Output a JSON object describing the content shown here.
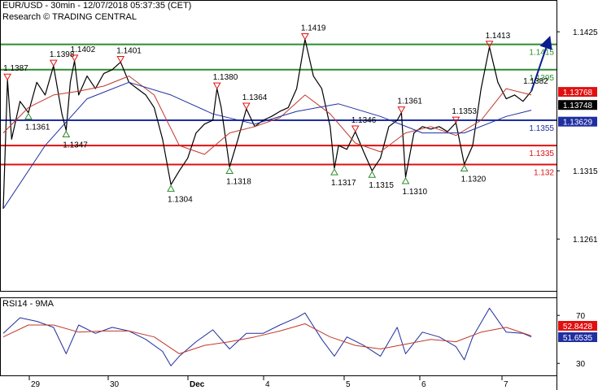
{
  "header": {
    "title": "EUR/USD - 30min - 12/07/2018 05:37:35 (CET)",
    "source": "Research © TRADING CENTRAL"
  },
  "colors": {
    "background": "#ffffff",
    "price": "#000000",
    "ma_fast": "#c0392b",
    "ma_slow": "#1f2fa0",
    "resistance": "#2e8b2e",
    "pivot": "#1f2f9f",
    "support": "#e01010",
    "arrow": "#0a1d8f",
    "last_price_bg": "#e01010",
    "current_bg": "#000000",
    "ma_tag_bg": "#1f2fa0"
  },
  "chart_data": [
    {
      "type": "line",
      "panel": "price",
      "ylim": [
        1.122,
        1.1445
      ],
      "yticks": [
        "1.1425",
        "1.1315",
        "1.1261"
      ],
      "xticks": [
        "29",
        "30",
        "Dec",
        "4",
        "5",
        "6",
        "7"
      ],
      "levels": [
        {
          "value": 1.1415,
          "label": "1.1415",
          "kind": "resistance"
        },
        {
          "value": 1.1395,
          "label": "1.1395",
          "kind": "resistance"
        },
        {
          "value": 1.1355,
          "label": "1.1355",
          "kind": "pivot"
        },
        {
          "value": 1.1335,
          "label": "1.1335",
          "kind": "support"
        },
        {
          "value": 1.132,
          "label": "1.132",
          "kind": "support"
        }
      ],
      "price_tags": [
        {
          "value": 1.13768,
          "label": "1.13768",
          "kind": "last"
        },
        {
          "value": 1.13748,
          "label": "1.13748",
          "kind": "current"
        },
        {
          "value": 1.13629,
          "label": "1.13629",
          "kind": "ma"
        }
      ],
      "annotations": [
        {
          "x": 0.5,
          "y": 1.1387,
          "label": "1.1387",
          "dir": "down"
        },
        {
          "x": 3.0,
          "y": 1.1361,
          "label": "1.1361",
          "dir": "up"
        },
        {
          "x": 6.0,
          "y": 1.1398,
          "label": "1.1398",
          "dir": "down"
        },
        {
          "x": 7.5,
          "y": 1.1347,
          "label": "1.1347",
          "dir": "up"
        },
        {
          "x": 8.5,
          "y": 1.1402,
          "label": "1.1402",
          "dir": "down"
        },
        {
          "x": 14.0,
          "y": 1.1401,
          "label": "1.1401",
          "dir": "down"
        },
        {
          "x": 20.0,
          "y": 1.1304,
          "label": "1.1304",
          "dir": "up"
        },
        {
          "x": 25.5,
          "y": 1.138,
          "label": "1.1380",
          "dir": "down"
        },
        {
          "x": 27.0,
          "y": 1.1318,
          "label": "1.1318",
          "dir": "up"
        },
        {
          "x": 29.0,
          "y": 1.1364,
          "label": "1.1364",
          "dir": "down"
        },
        {
          "x": 36.0,
          "y": 1.1419,
          "label": "1.1419",
          "dir": "down"
        },
        {
          "x": 39.5,
          "y": 1.1317,
          "label": "1.1317",
          "dir": "up"
        },
        {
          "x": 42.0,
          "y": 1.1346,
          "label": "1.1346",
          "dir": "down"
        },
        {
          "x": 44.0,
          "y": 1.1315,
          "label": "1.1315",
          "dir": "up"
        },
        {
          "x": 47.5,
          "y": 1.1361,
          "label": "1.1361",
          "dir": "down"
        },
        {
          "x": 48.0,
          "y": 1.131,
          "label": "1.1310",
          "dir": "up"
        },
        {
          "x": 54.0,
          "y": 1.1353,
          "label": "1.1353",
          "dir": "down"
        },
        {
          "x": 55.0,
          "y": 1.132,
          "label": "1.1320",
          "dir": "up"
        },
        {
          "x": 58.0,
          "y": 1.1413,
          "label": "1.1413",
          "dir": "down"
        },
        {
          "x": 63.0,
          "y": 1.1382,
          "label": "1.1382",
          "dir": "none"
        }
      ],
      "projection": {
        "from": [
          63.0,
          1.1378
        ],
        "to": [
          65.0,
          1.1417
        ]
      },
      "series": [
        {
          "role": "price",
          "x": [
            0,
            0.5,
            1,
            2,
            3,
            4,
            5,
            6,
            7,
            7.5,
            8,
            8.5,
            9,
            10,
            11,
            12,
            13,
            14,
            15,
            16,
            17,
            18,
            19,
            20,
            21,
            22,
            23,
            24,
            25,
            25.5,
            26,
            27,
            28,
            29,
            30,
            31,
            32,
            33,
            34,
            35,
            36,
            37,
            38,
            39,
            39.5,
            40,
            41,
            42,
            43,
            44,
            45,
            46,
            47,
            47.5,
            48,
            49,
            50,
            51,
            52,
            53,
            54,
            55,
            56,
            57,
            58,
            59,
            60,
            61,
            62,
            63
          ],
          "values": [
            1.1285,
            1.1387,
            1.134,
            1.137,
            1.1361,
            1.1385,
            1.1375,
            1.1398,
            1.136,
            1.1347,
            1.1385,
            1.1402,
            1.1375,
            1.139,
            1.138,
            1.1392,
            1.1395,
            1.1401,
            1.1385,
            1.138,
            1.1375,
            1.1365,
            1.134,
            1.1304,
            1.1315,
            1.1325,
            1.1345,
            1.1352,
            1.1355,
            1.138,
            1.1365,
            1.1318,
            1.134,
            1.1364,
            1.135,
            1.1355,
            1.1358,
            1.1362,
            1.1365,
            1.138,
            1.1419,
            1.139,
            1.138,
            1.135,
            1.1317,
            1.1335,
            1.1332,
            1.1346,
            1.133,
            1.1315,
            1.1325,
            1.135,
            1.1355,
            1.1361,
            1.131,
            1.1345,
            1.135,
            1.1348,
            1.135,
            1.1346,
            1.1353,
            1.132,
            1.1335,
            1.138,
            1.1413,
            1.1385,
            1.1372,
            1.1375,
            1.137,
            1.1378
          ]
        },
        {
          "role": "ma_fast",
          "x": [
            0,
            3,
            6,
            9,
            12,
            15,
            18,
            21,
            24,
            27,
            30,
            33,
            36,
            39,
            42,
            45,
            48,
            51,
            54,
            57,
            60,
            63
          ],
          "values": [
            1.1345,
            1.1365,
            1.1375,
            1.1378,
            1.1382,
            1.139,
            1.1375,
            1.1335,
            1.1328,
            1.1345,
            1.135,
            1.1357,
            1.1375,
            1.136,
            1.1337,
            1.133,
            1.1345,
            1.135,
            1.1343,
            1.1355,
            1.138,
            1.1375
          ]
        },
        {
          "role": "ma_slow",
          "x": [
            0,
            5,
            10,
            15,
            20,
            25,
            30,
            35,
            40,
            45,
            50,
            55,
            60,
            63
          ],
          "values": [
            1.1285,
            1.1335,
            1.1372,
            1.1385,
            1.1375,
            1.136,
            1.1352,
            1.1362,
            1.1368,
            1.1358,
            1.1345,
            1.1345,
            1.1358,
            1.1363
          ]
        }
      ]
    },
    {
      "type": "line",
      "panel": "rsi",
      "title": "RSI14 - 9MA",
      "ylim": [
        20,
        85
      ],
      "yticks": [
        "70",
        "30"
      ],
      "value_tags": [
        {
          "value": 52.8428,
          "label": "52.8428",
          "kind": "ma"
        },
        {
          "value": 51.6535,
          "label": "51.6535",
          "kind": "rsi"
        }
      ],
      "series": [
        {
          "role": "rsi",
          "x": [
            0,
            2,
            4,
            6,
            7.5,
            9,
            11,
            13,
            15,
            17,
            19,
            20,
            21,
            23,
            25,
            27,
            29,
            31,
            33,
            35,
            36,
            38,
            39.5,
            41,
            43,
            45,
            47,
            48,
            50,
            52,
            54,
            55,
            56,
            58,
            60,
            62,
            63
          ],
          "values": [
            55,
            68,
            65,
            60,
            38,
            62,
            55,
            60,
            57,
            50,
            40,
            28,
            36,
            48,
            58,
            42,
            55,
            55,
            62,
            68,
            72,
            50,
            36,
            52,
            45,
            36,
            60,
            38,
            56,
            52,
            44,
            33,
            52,
            76,
            56,
            55,
            52
          ]
        },
        {
          "role": "rsi_ma",
          "x": [
            0,
            3,
            6,
            9,
            12,
            15,
            18,
            21,
            24,
            27,
            30,
            33,
            36,
            39,
            42,
            45,
            48,
            51,
            54,
            57,
            60,
            63
          ],
          "values": [
            52,
            62,
            62,
            56,
            57,
            57,
            52,
            38,
            45,
            48,
            52,
            57,
            63,
            52,
            45,
            42,
            46,
            50,
            48,
            56,
            60,
            53
          ]
        }
      ]
    }
  ]
}
